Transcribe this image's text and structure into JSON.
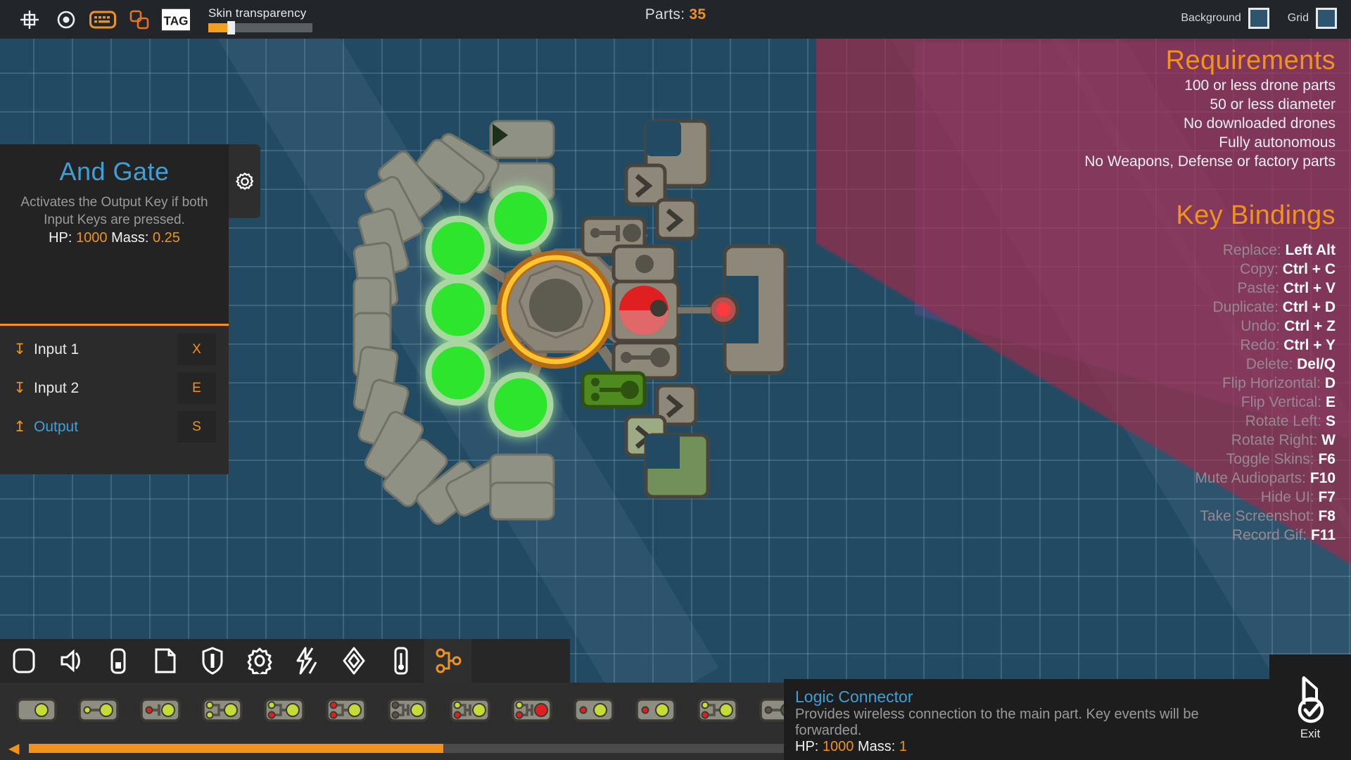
{
  "topbar": {
    "icons": [
      {
        "name": "grid-snap-icon",
        "label": "Grid Snap"
      },
      {
        "name": "center-point-icon",
        "label": "Center Point"
      },
      {
        "name": "keyboard-icon",
        "label": "Keyboard"
      },
      {
        "name": "duplicate-icon",
        "label": "Duplicate"
      },
      {
        "name": "tag-icon",
        "label": "TAG"
      }
    ],
    "skin_transparency_label": "Skin transparency",
    "skin_transparency_value": 18,
    "parts_label": "Parts:",
    "parts_value": "35",
    "background_label": "Background",
    "background_color": "#2e5470",
    "grid_label": "Grid",
    "grid_color": "#2e5470"
  },
  "info_panel": {
    "title": "And Gate",
    "description": "Activates the Output Key if both Input Keys are pressed.",
    "hp_label": "HP:",
    "hp_value": "1000",
    "mass_label": "Mass:",
    "mass_value": "0.25",
    "io": [
      {
        "arrow": "down",
        "name": "Input 1",
        "key": "X"
      },
      {
        "arrow": "down",
        "name": "Input 2",
        "key": "E"
      },
      {
        "arrow": "up",
        "name": "Output",
        "key": "S"
      }
    ]
  },
  "requirements": {
    "title": "Requirements",
    "items": [
      "100 or less drone parts",
      "50 or less diameter",
      "No downloaded drones",
      "Fully autonomous",
      "No Weapons, Defense or factory parts"
    ]
  },
  "key_bindings": {
    "title": "Key Bindings",
    "items": [
      {
        "label": "Replace:",
        "value": "Left Alt"
      },
      {
        "label": "Copy:",
        "value": "Ctrl + C"
      },
      {
        "label": "Paste:",
        "value": "Ctrl + V"
      },
      {
        "label": "Duplicate:",
        "value": "Ctrl + D"
      },
      {
        "label": "Undo:",
        "value": "Ctrl + Z"
      },
      {
        "label": "Redo:",
        "value": "Ctrl + Y"
      },
      {
        "label": "Delete:",
        "value": "Del/Q"
      },
      {
        "label": "Flip Horizontal:",
        "value": "D"
      },
      {
        "label": "Flip Vertical:",
        "value": "E"
      },
      {
        "label": "Rotate Left:",
        "value": "S"
      },
      {
        "label": "Rotate Right:",
        "value": "W"
      },
      {
        "label": "Toggle Skins:",
        "value": "F6"
      },
      {
        "label": "Mute Audioparts:",
        "value": "F10"
      },
      {
        "label": "Hide UI:",
        "value": "F7"
      },
      {
        "label": "Take Screenshot:",
        "value": "F8"
      },
      {
        "label": "Record Gif:",
        "value": "F11"
      }
    ]
  },
  "categories": [
    {
      "name": "block-icon",
      "label": "Blocks",
      "active": false
    },
    {
      "name": "speaker-icon",
      "label": "Audio",
      "active": false
    },
    {
      "name": "battery-icon",
      "label": "Power",
      "active": false
    },
    {
      "name": "page-icon",
      "label": "Panels",
      "active": false
    },
    {
      "name": "shield-icon",
      "label": "Defense",
      "active": false
    },
    {
      "name": "gear-icon",
      "label": "Mechanical",
      "active": false
    },
    {
      "name": "lightning-icon",
      "label": "Energy",
      "active": false
    },
    {
      "name": "diamond-icon",
      "label": "Decoration",
      "active": false
    },
    {
      "name": "thermometer-icon",
      "label": "Sensors",
      "active": false
    },
    {
      "name": "logic-node-icon",
      "label": "Logic",
      "active": true
    }
  ],
  "parts_strip": {
    "scroll_left_label": "◀",
    "scroll_value": 46,
    "items": [
      {
        "name": "constant-part",
        "type": "single",
        "out": "green"
      },
      {
        "name": "buffer-part",
        "type": "one-in",
        "in1": "green",
        "out": "green"
      },
      {
        "name": "not-part",
        "type": "one-in-bar",
        "in1": "red",
        "out": "green"
      },
      {
        "name": "and-part",
        "type": "two-in",
        "in1": "green",
        "in2": "green",
        "out": "green"
      },
      {
        "name": "and-mixed-part",
        "type": "two-in",
        "in1": "green",
        "in2": "red",
        "out": "green"
      },
      {
        "name": "nor-part",
        "type": "two-in",
        "in1": "red",
        "in2": "red",
        "out": "green"
      },
      {
        "name": "nand-part",
        "type": "two-in-bar",
        "in1": "dark",
        "in2": "dark",
        "out": "green"
      },
      {
        "name": "xor-part",
        "type": "two-in-bar",
        "in1": "green",
        "in2": "red",
        "out": "green"
      },
      {
        "name": "xnor-part",
        "type": "two-in-bar",
        "in1": "green",
        "in2": "red",
        "out": "red"
      },
      {
        "name": "toggle-part",
        "type": "pair",
        "in1": "red",
        "out": "green"
      },
      {
        "name": "latch-part",
        "type": "pair",
        "in1": "red",
        "out": "green"
      },
      {
        "name": "delay-part",
        "type": "two-in",
        "in1": "green",
        "in2": "red",
        "out": "green"
      },
      {
        "name": "connector-part",
        "type": "one-in",
        "in1": "dark",
        "out": "dark"
      }
    ]
  },
  "tooltip": {
    "title": "Logic Connector",
    "description": "Provides wireless connection to the main part. Key events will be forwarded.",
    "hp_label": "HP:",
    "hp_value": "1000",
    "mass_label": "Mass:",
    "mass_value": "1"
  },
  "exit": {
    "label": "Exit"
  }
}
